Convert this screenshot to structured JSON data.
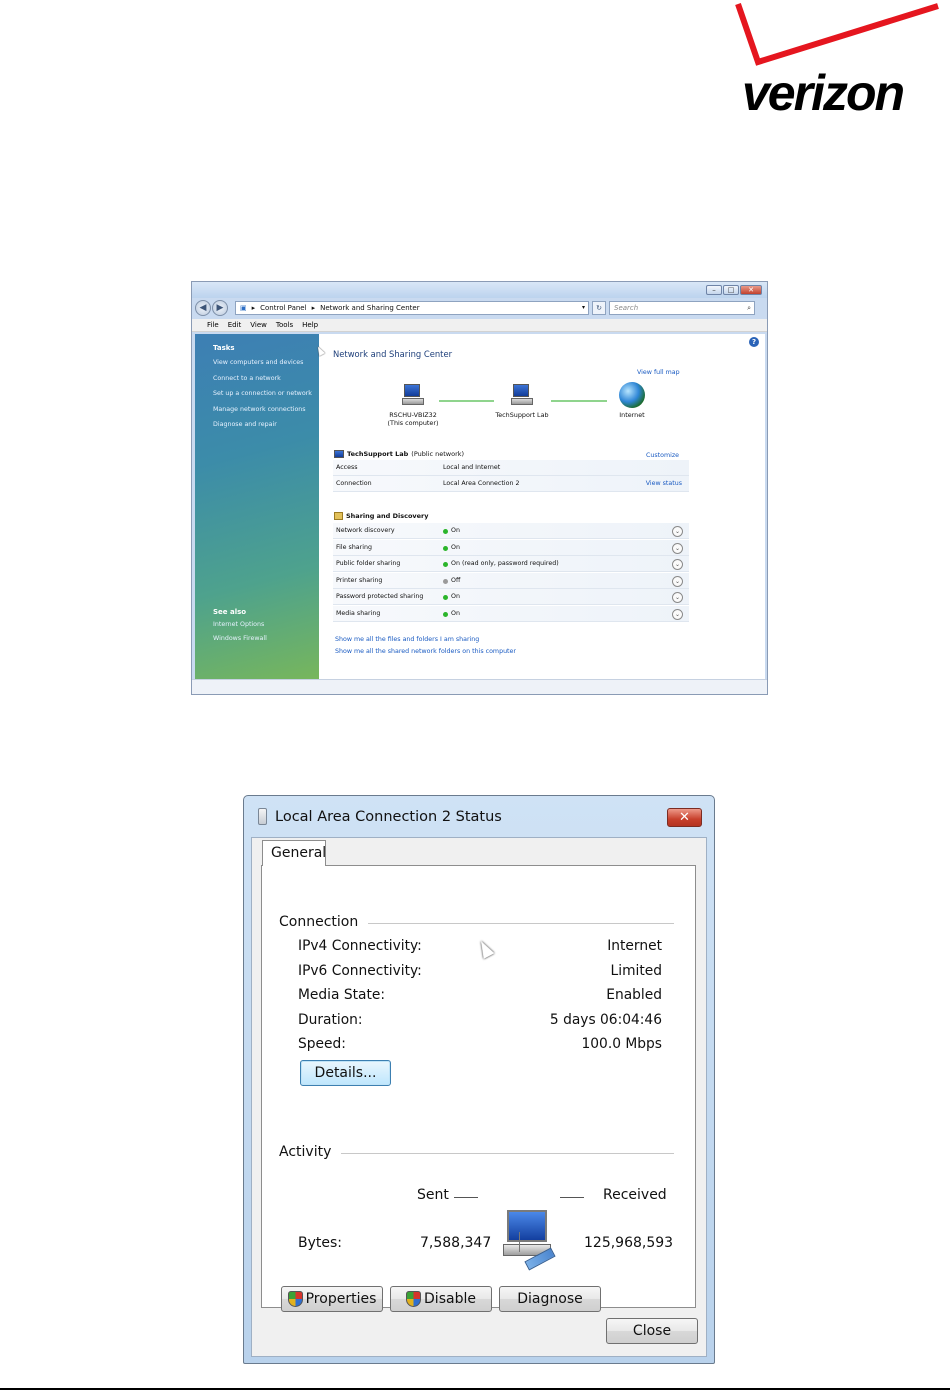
{
  "logo": {
    "text": "verizon"
  },
  "network_center": {
    "breadcrumb": [
      "Control Panel",
      "Network and Sharing Center"
    ],
    "search_placeholder": "Search",
    "menu": [
      "File",
      "Edit",
      "View",
      "Tools",
      "Help"
    ],
    "sidebar": {
      "tasks_heading": "Tasks",
      "tasks": [
        "View computers and devices",
        "Connect to a network",
        "Set up a connection or network",
        "Manage network connections",
        "Diagnose and repair"
      ],
      "see_also_heading": "See also",
      "see_also": [
        "Internet Options",
        "Windows Firewall"
      ]
    },
    "title": "Network and Sharing Center",
    "view_full_map": "View full map",
    "map": {
      "computer_name": "RSCHU-VBIZ32",
      "computer_sub": "(This computer)",
      "network_name": "TechSupport Lab",
      "internet": "Internet"
    },
    "network": {
      "name": "TechSupport Lab",
      "type": "(Public network)",
      "customize": "Customize",
      "rows": [
        {
          "label": "Access",
          "value": "Local and Internet",
          "action": ""
        },
        {
          "label": "Connection",
          "value": "Local Area Connection 2",
          "action": "View status"
        }
      ]
    },
    "sharing": {
      "heading": "Sharing and Discovery",
      "rows": [
        {
          "label": "Network discovery",
          "value": "On",
          "state": "on"
        },
        {
          "label": "File sharing",
          "value": "On",
          "state": "on"
        },
        {
          "label": "Public folder sharing",
          "value": "On (read only, password required)",
          "state": "on"
        },
        {
          "label": "Printer sharing",
          "value": "Off",
          "state": "off"
        },
        {
          "label": "Password protected sharing",
          "value": "On",
          "state": "on"
        },
        {
          "label": "Media sharing",
          "value": "On",
          "state": "on"
        }
      ]
    },
    "bottom_links": [
      "Show me all the files and folders I am sharing",
      "Show me all the shared network folders on this computer"
    ]
  },
  "status_dialog": {
    "title": "Local Area Connection 2 Status",
    "close_glyph": "✕",
    "tab": "General",
    "connection_heading": "Connection",
    "connection": [
      {
        "label": "IPv4 Connectivity:",
        "value": "Internet"
      },
      {
        "label": "IPv6 Connectivity:",
        "value": "Limited"
      },
      {
        "label": "Media State:",
        "value": "Enabled"
      },
      {
        "label": "Duration:",
        "value": "5 days 06:04:46"
      },
      {
        "label": "Speed:",
        "value": "100.0 Mbps"
      }
    ],
    "details_button": "Details...",
    "activity_heading": "Activity",
    "sent_label": "Sent",
    "received_label": "Received",
    "bytes_label": "Bytes:",
    "bytes_sent": "7,588,347",
    "bytes_received": "125,968,593",
    "properties_button": "Properties",
    "disable_button": "Disable",
    "diagnose_button": "Diagnose",
    "close_button": "Close"
  }
}
